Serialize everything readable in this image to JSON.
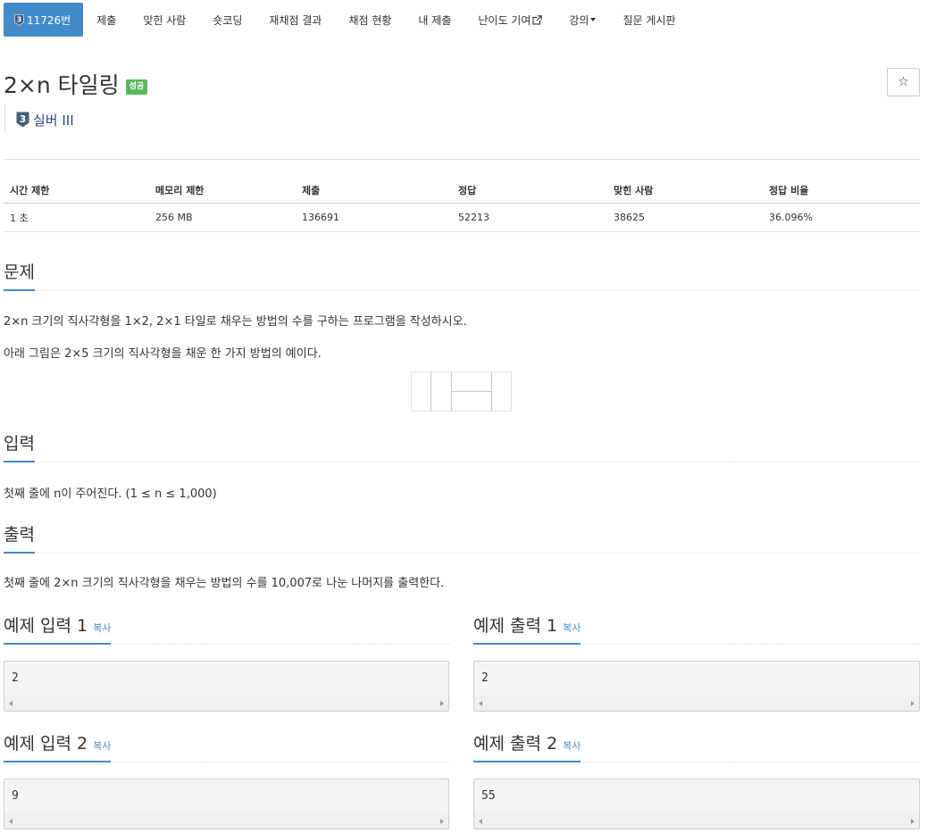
{
  "nav": {
    "problem_tab": "11726번",
    "submit": "제출",
    "solvers": "맞힌 사람",
    "shortcoding": "숏코딩",
    "rejudge": "재채점 결과",
    "status": "채점 현황",
    "my_submit": "내 제출",
    "difficulty": "난이도 기여",
    "lecture": "강의",
    "board": "질문 게시판"
  },
  "problem": {
    "title": "2×n 타일링",
    "badge": "성공",
    "tier": "실버 III",
    "tier_number": "3",
    "star": "☆"
  },
  "info": {
    "headers": [
      "시간 제한",
      "메모리 제한",
      "제출",
      "정답",
      "맞힌 사람",
      "정답 비율"
    ],
    "values": [
      "1 초",
      "256 MB",
      "136691",
      "52213",
      "38625",
      "36.096%"
    ]
  },
  "sections": {
    "problem": "문제",
    "problem_text_1": "2×n 크기의 직사각형을 1×2, 2×1 타일로 채우는 방법의 수를 구하는 프로그램을 작성하시오.",
    "problem_text_2": "아래 그림은 2×5 크기의 직사각형을 채운 한 가지 방법의 예이다.",
    "input": "입력",
    "input_text": "첫째 줄에 n이 주어진다. (1 ≤ n ≤ 1,000)",
    "output": "출력",
    "output_text": "첫째 줄에 2×n 크기의 직사각형을 채우는 방법의 수를 10,007로 나눈 나머지를 출력한다."
  },
  "samples": [
    {
      "in_label": "예제 입력",
      "in_num": "1",
      "out_label": "예제 출력",
      "out_num": "1",
      "copy": "복사",
      "input": "2",
      "output": "2"
    },
    {
      "in_label": "예제 입력",
      "in_num": "2",
      "out_label": "예제 출력",
      "out_num": "2",
      "copy": "복사",
      "input": "9",
      "output": "55"
    }
  ],
  "colors": {
    "primary": "#428bca",
    "success": "#5cb85c",
    "tier_silver": "#435f7a"
  },
  "icons": {
    "tier": "silver-tier-icon",
    "external": "external-link-icon",
    "star": "star-icon",
    "caret": "caret-down-icon"
  }
}
